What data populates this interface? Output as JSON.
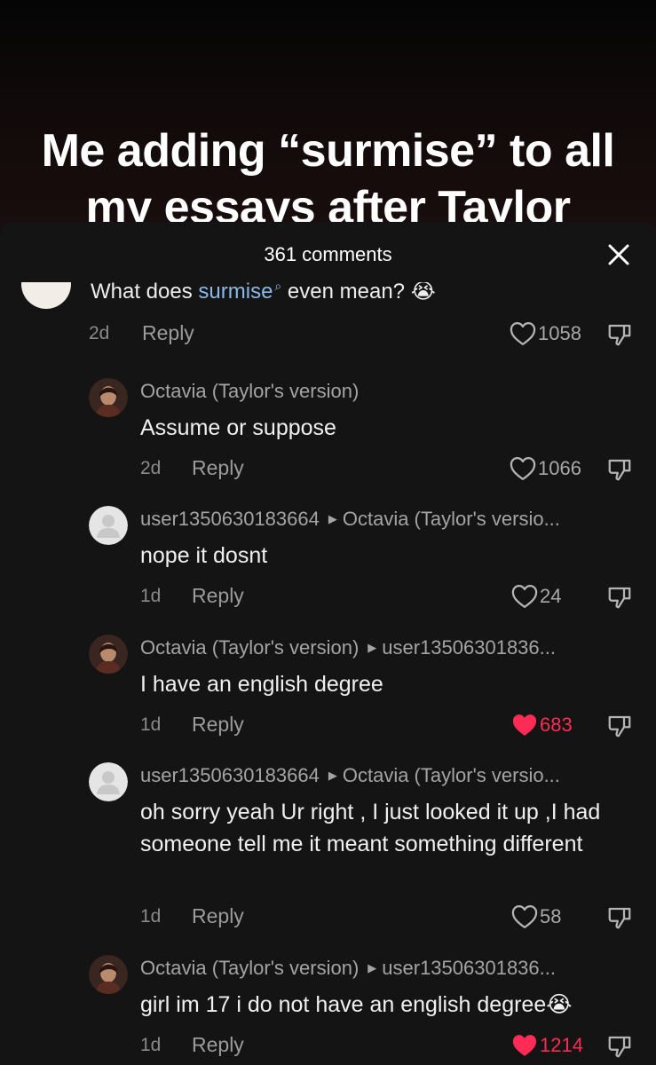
{
  "video": {
    "caption_line1": "Me adding “surmise” to all",
    "caption_line2": "my essays after Taylor"
  },
  "sheet": {
    "title": "361 comments"
  },
  "parent_comment": {
    "text_before": "What does ",
    "highlight": "surmise",
    "text_after": " even mean? 😭",
    "time": "2d",
    "reply_label": "Reply",
    "likes": "1058"
  },
  "replies": [
    {
      "author": "Octavia (Taylor's version)",
      "reply_to": "",
      "text": "Assume or suppose",
      "time": "2d",
      "reply_label": "Reply",
      "likes": "1066",
      "liked": false
    },
    {
      "author": "user1350630183664",
      "reply_to": "Octavia (Taylor's versio...",
      "text": "nope it dosnt",
      "time": "1d",
      "reply_label": "Reply",
      "likes": "24",
      "liked": false
    },
    {
      "author": "Octavia (Taylor's version)",
      "reply_to": "user13506301836...",
      "text": "I have an english degree",
      "time": "1d",
      "reply_label": "Reply",
      "likes": "683",
      "liked": true
    },
    {
      "author": "user1350630183664",
      "reply_to": "Octavia (Taylor's versio...",
      "text": "oh sorry yeah Ur right , I just looked it up ,I had someone tell me it meant something different",
      "time": "1d",
      "reply_label": "Reply",
      "likes": "58",
      "liked": false
    },
    {
      "author": "Octavia (Taylor's version)",
      "reply_to": "user13506301836...",
      "text": "girl im 17 i do not have an english degree😭",
      "time": "1d",
      "reply_label": "Reply",
      "likes": "1214",
      "liked": true
    }
  ],
  "colors": {
    "background": "#141414",
    "like_active": "#fe2c55",
    "mention_link": "#8ab8e8"
  },
  "icons": [
    "close-icon",
    "heart-icon",
    "heart-filled-icon",
    "dislike-icon",
    "default-avatar-icon",
    "search-hint-icon"
  ]
}
